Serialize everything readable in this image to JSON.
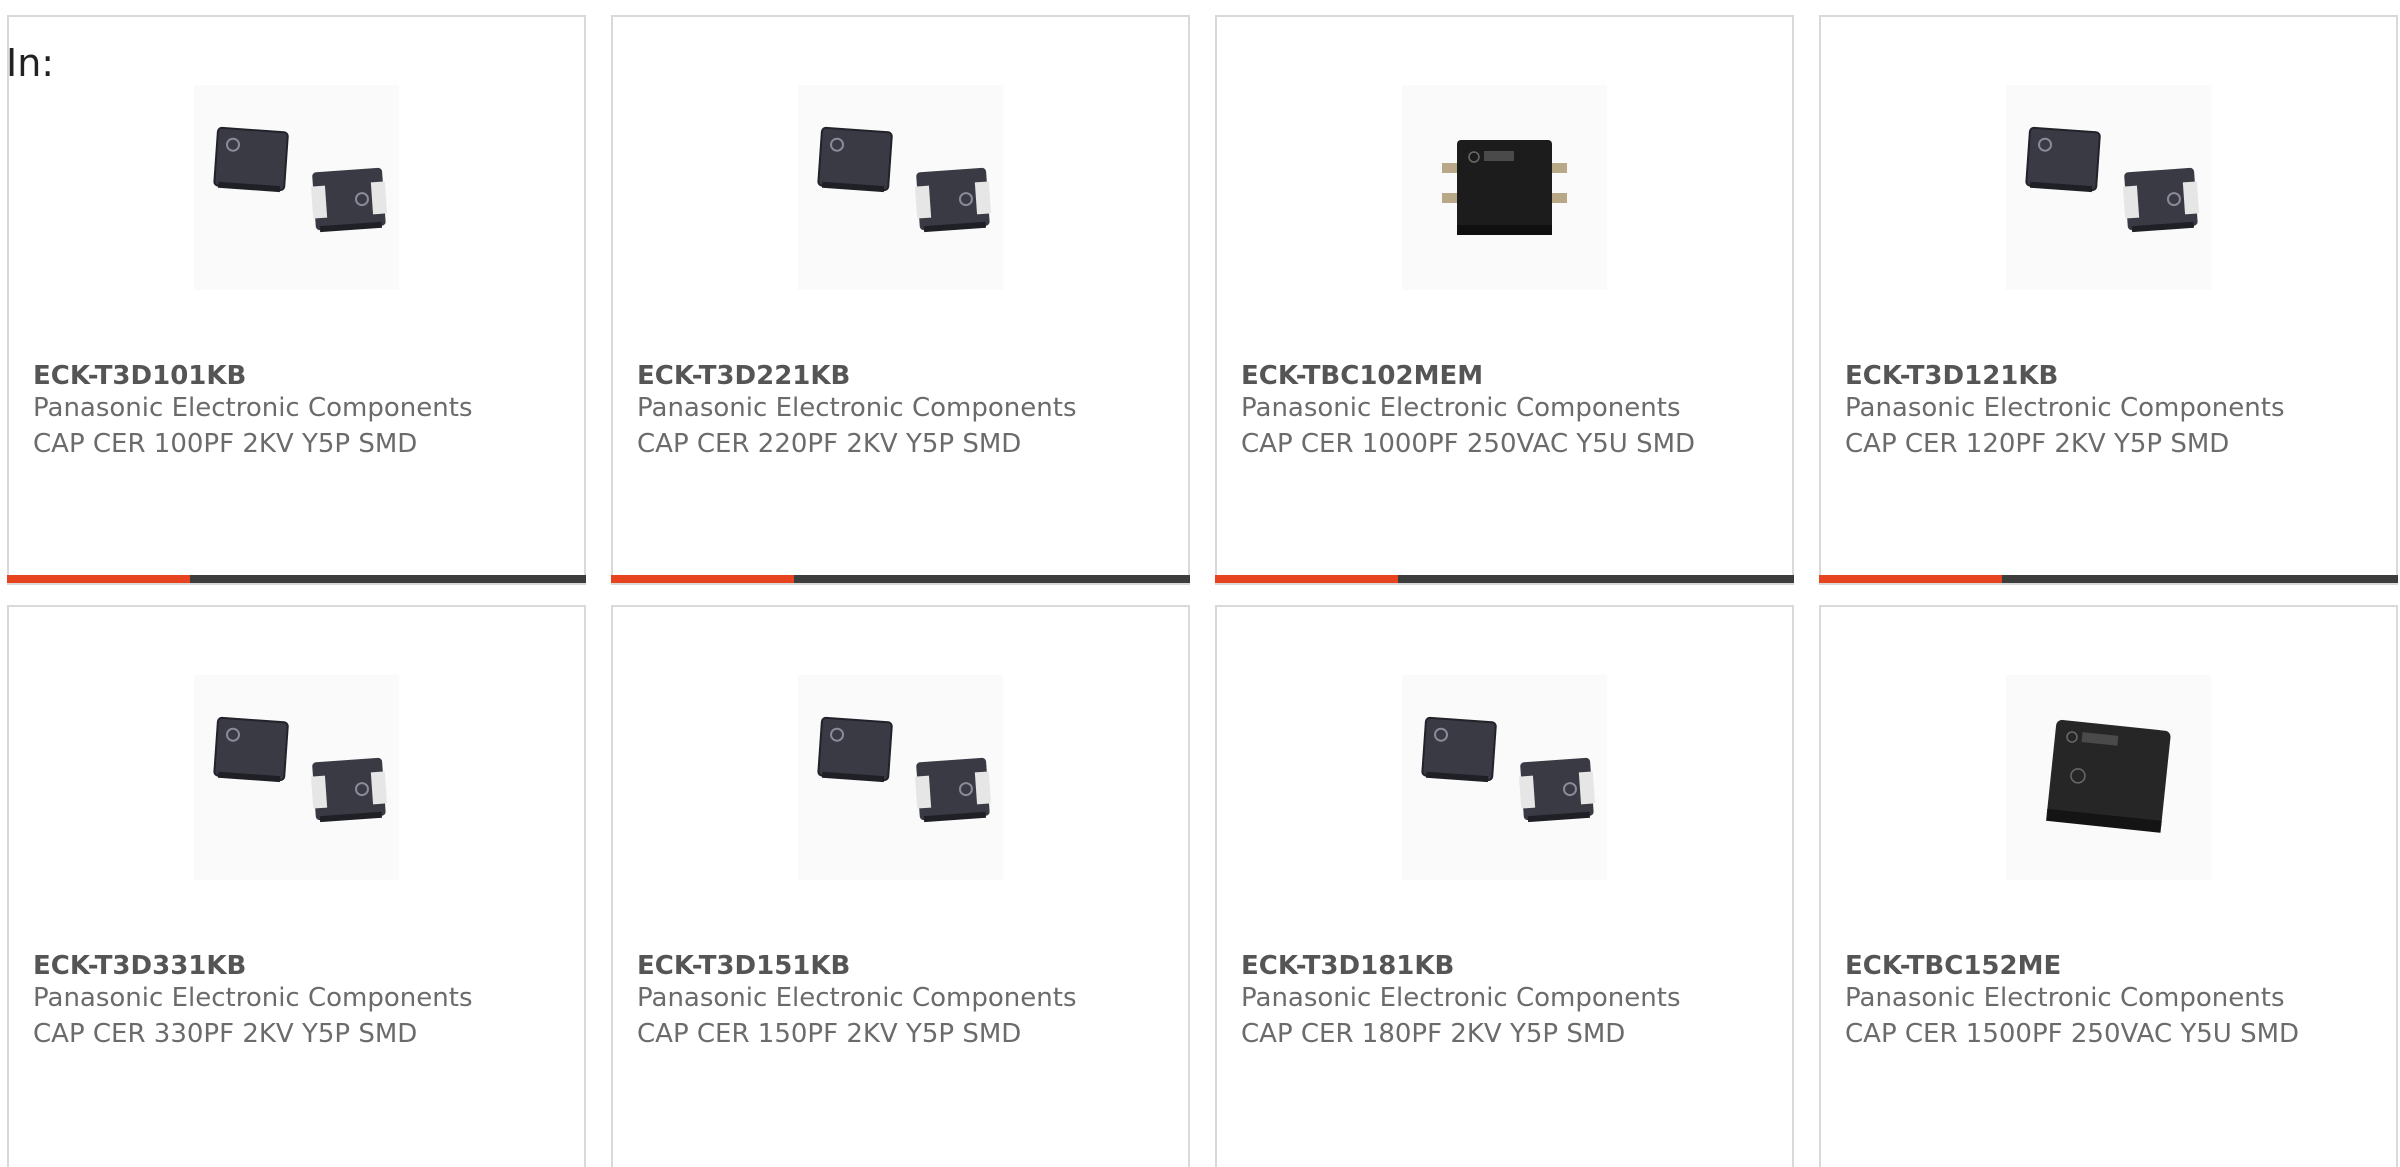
{
  "filter": {
    "label": "In:"
  },
  "colors": {
    "accent": "#e8431f",
    "bar": "#3d3d3d",
    "border": "#d9d9d9"
  },
  "products": [
    {
      "part_number": "ECK-T3D101KB",
      "manufacturer": "Panasonic Electronic Components",
      "description": "CAP CER 100PF 2KV Y5P SMD",
      "image": "smd-capacitor-pair",
      "show_bar": true
    },
    {
      "part_number": "ECK-T3D221KB",
      "manufacturer": "Panasonic Electronic Components",
      "description": "CAP CER 220PF 2KV Y5P SMD",
      "image": "smd-capacitor-pair",
      "show_bar": true
    },
    {
      "part_number": "ECK-TBC102MEM",
      "manufacturer": "Panasonic Electronic Components",
      "description": "CAP CER 1000PF 250VAC Y5U SMD",
      "image": "smd-capacitor-leaded",
      "show_bar": true
    },
    {
      "part_number": "ECK-T3D121KB",
      "manufacturer": "Panasonic Electronic Components",
      "description": "CAP CER 120PF 2KV Y5P SMD",
      "image": "smd-capacitor-pair",
      "show_bar": true
    },
    {
      "part_number": "ECK-T3D331KB",
      "manufacturer": "Panasonic Electronic Components",
      "description": "CAP CER 330PF 2KV Y5P SMD",
      "image": "smd-capacitor-pair",
      "show_bar": false
    },
    {
      "part_number": "ECK-T3D151KB",
      "manufacturer": "Panasonic Electronic Components",
      "description": "CAP CER 150PF 2KV Y5P SMD",
      "image": "smd-capacitor-pair",
      "show_bar": false
    },
    {
      "part_number": "ECK-T3D181KB",
      "manufacturer": "Panasonic Electronic Components",
      "description": "CAP CER 180PF 2KV Y5P SMD",
      "image": "smd-capacitor-pair",
      "show_bar": false
    },
    {
      "part_number": "ECK-TBC152ME",
      "manufacturer": "Panasonic Electronic Components",
      "description": "CAP CER 1500PF 250VAC Y5U SMD",
      "image": "smd-capacitor-block",
      "show_bar": false
    }
  ]
}
